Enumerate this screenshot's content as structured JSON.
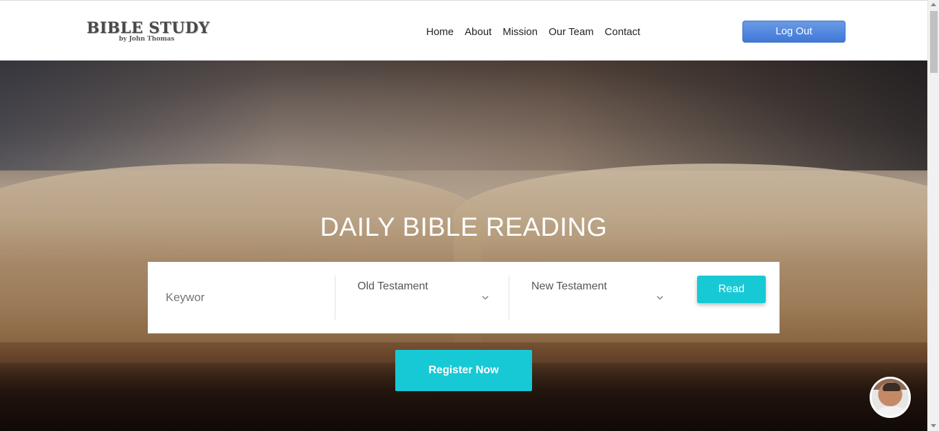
{
  "header": {
    "logo_title": "BIBLE STUDY",
    "logo_subtitle": "by John Thomas",
    "nav": [
      {
        "label": "Home"
      },
      {
        "label": "About"
      },
      {
        "label": "Mission"
      },
      {
        "label": "Our Team"
      },
      {
        "label": "Contact"
      }
    ],
    "logout_label": "Log Out",
    "logout_color": "#4a83dd"
  },
  "hero": {
    "title": "DAILY BIBLE READING",
    "search": {
      "keyword_placeholder": "Keywor",
      "old_testament_selected": "Old Testament",
      "new_testament_selected": "New Testament",
      "read_label": "Read"
    },
    "register_label": "Register Now",
    "accent_color": "#17c9d5"
  },
  "chat": {
    "avatar_icon": "user-avatar-icon"
  }
}
